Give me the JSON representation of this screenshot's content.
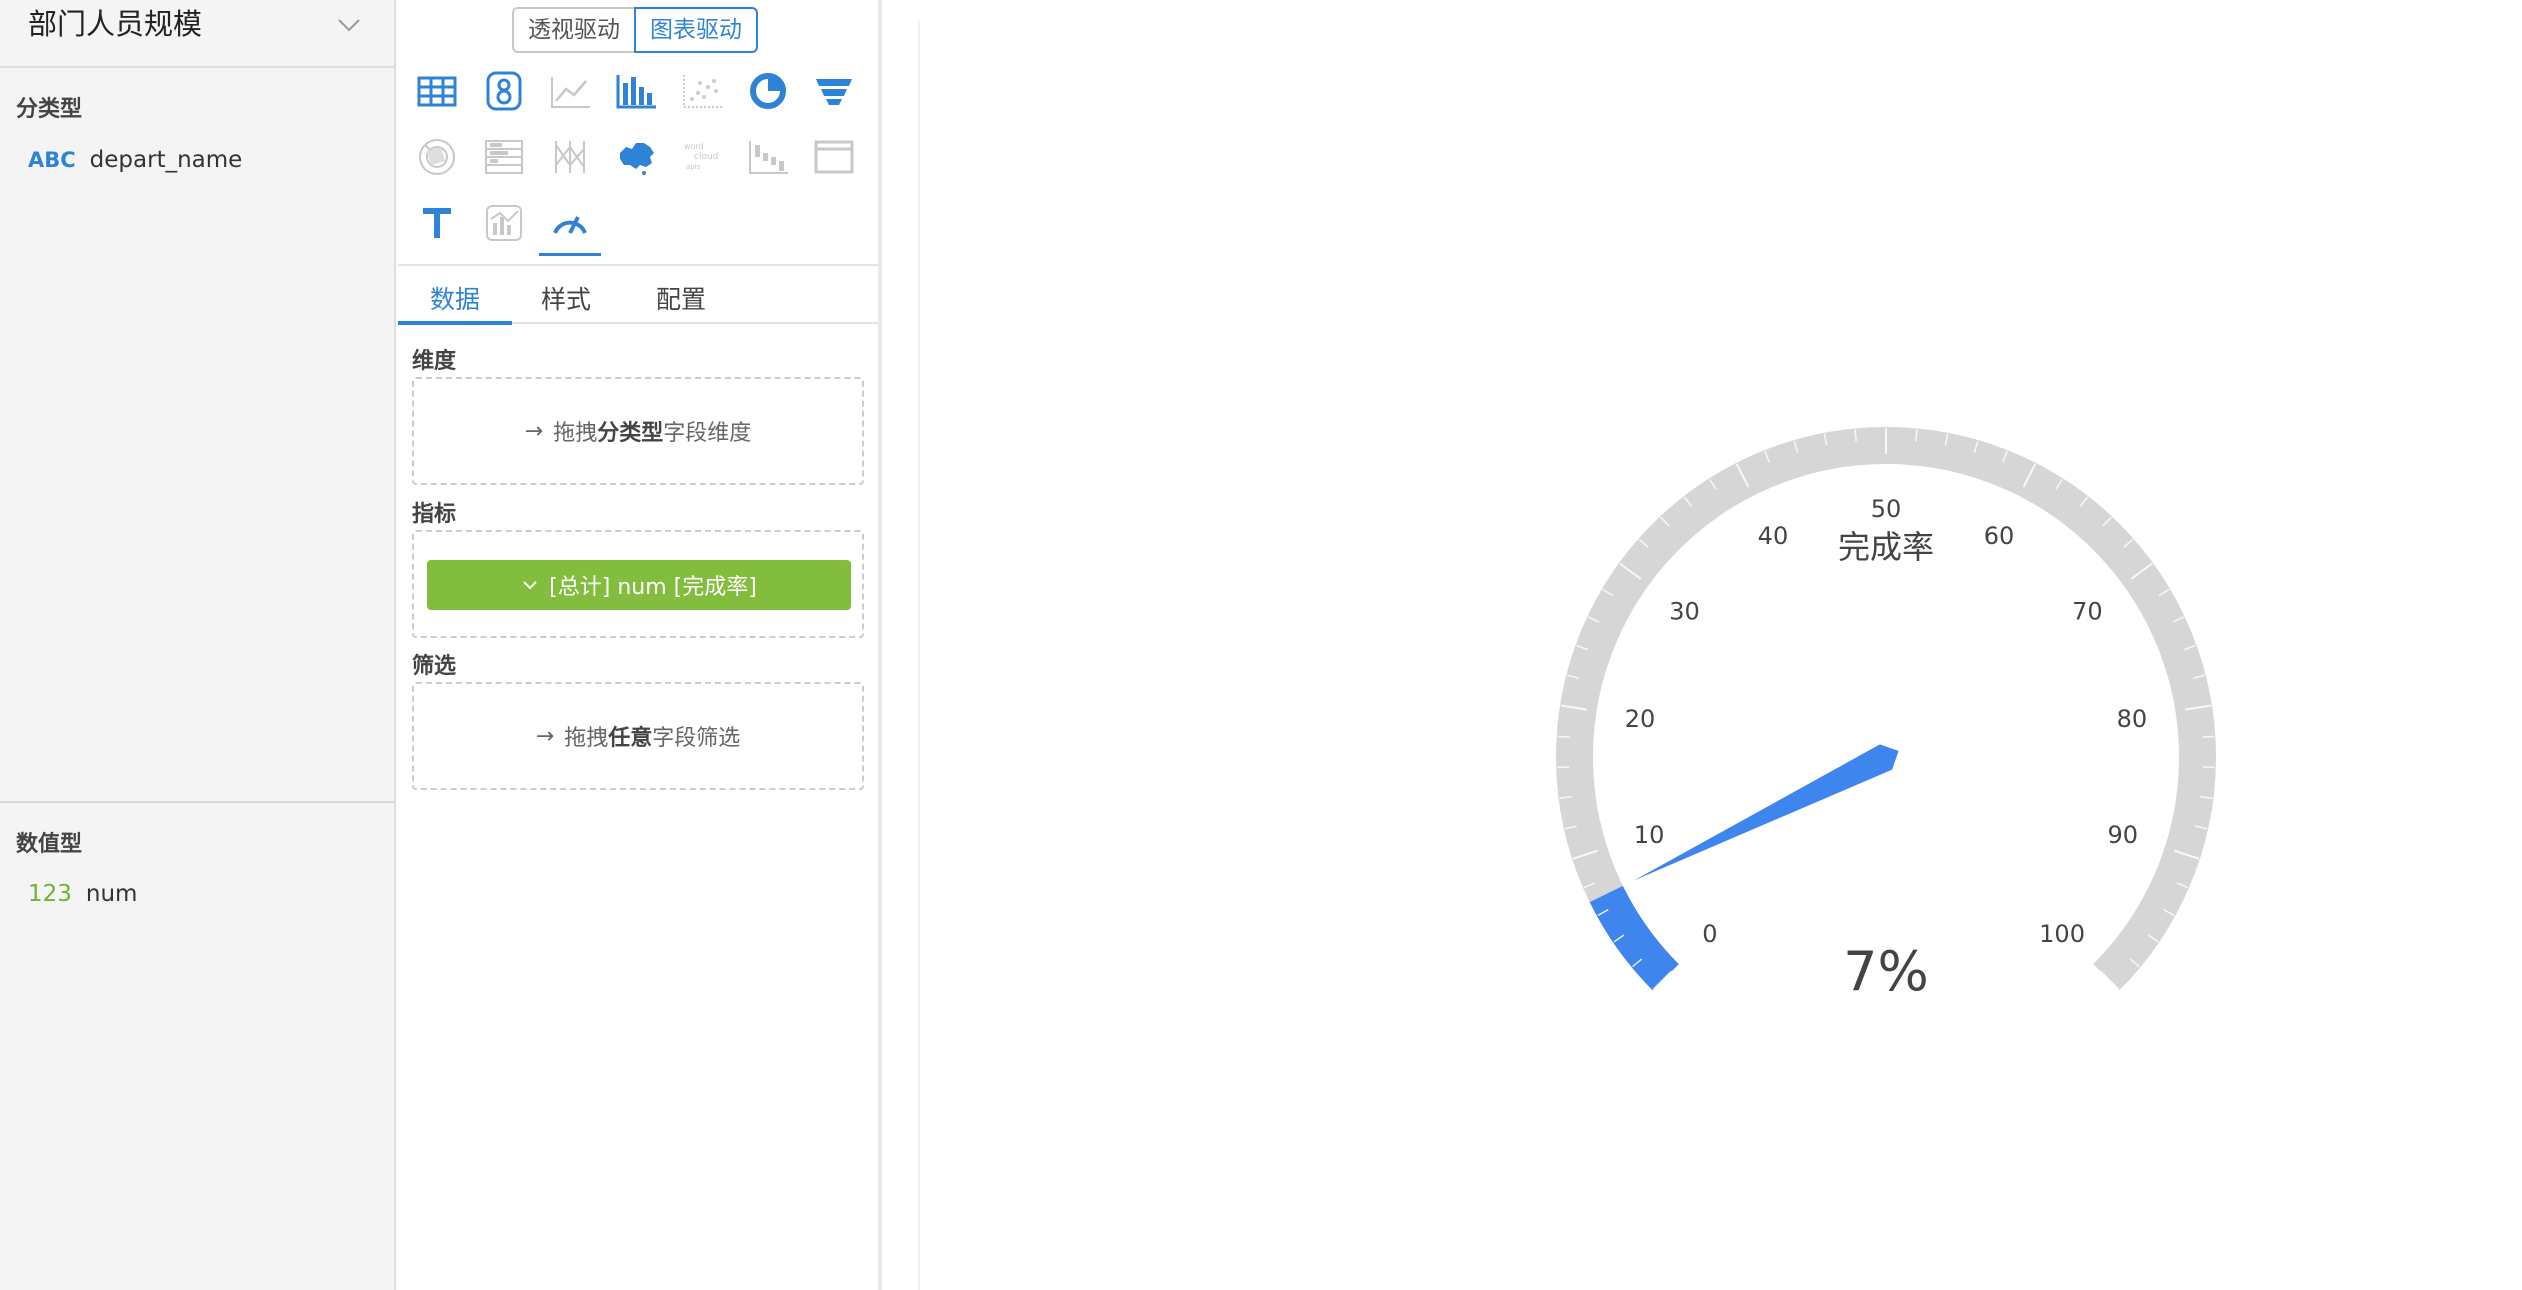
{
  "source": {
    "title": "部门人员规模"
  },
  "field_groups": [
    {
      "label": "分类型",
      "fields": [
        {
          "type_label": "ABC",
          "name": "depart_name",
          "type_color": "#2f83d6"
        }
      ]
    },
    {
      "label": "数值型",
      "fields": [
        {
          "type_label": "123",
          "name": "num",
          "type_color": "#6fb330"
        }
      ]
    }
  ],
  "mode_switch": {
    "options": [
      "透视驱动",
      "图表驱动"
    ],
    "active": "图表驱动"
  },
  "chart_types": [
    {
      "icon": "table-icon",
      "enabled": true
    },
    {
      "icon": "scorecard-icon",
      "enabled": true
    },
    {
      "icon": "line-chart-icon",
      "enabled": false
    },
    {
      "icon": "bar-chart-icon",
      "enabled": true
    },
    {
      "icon": "scatter-icon",
      "enabled": false
    },
    {
      "icon": "pie-chart-icon",
      "enabled": true
    },
    {
      "icon": "funnel-icon",
      "enabled": true
    },
    {
      "icon": "radar-icon",
      "enabled": false
    },
    {
      "icon": "parallel-bar-icon",
      "enabled": false
    },
    {
      "icon": "parallel-icon",
      "enabled": false
    },
    {
      "icon": "china-map-icon",
      "enabled": true
    },
    {
      "icon": "word-cloud-icon",
      "enabled": false
    },
    {
      "icon": "waterfall-icon",
      "enabled": false
    },
    {
      "icon": "web-widget-icon",
      "enabled": false
    },
    {
      "icon": "text-icon",
      "enabled": true
    },
    {
      "icon": "doubleaxis-icon",
      "enabled": false
    },
    {
      "icon": "gauge-icon",
      "enabled": true,
      "selected": true
    }
  ],
  "tabs": [
    "数据",
    "样式",
    "配置"
  ],
  "active_tab": "数据",
  "sections": {
    "dimension": {
      "label": "维度",
      "hint_prefix": "拖拽",
      "hint_bold": "分类型",
      "hint_suffix": "字段维度"
    },
    "metrics": {
      "label": "指标",
      "pill": "[总计] num [完成率]"
    },
    "filter": {
      "label": "筛选",
      "hint_prefix": "拖拽",
      "hint_bold": "任意",
      "hint_suffix": "字段筛选"
    }
  },
  "colors": {
    "accent": "#2f83d6",
    "gauge_fill": "#3e86ee",
    "gauge_track": "#d6d6d6",
    "metric_pill": "#82bd3e"
  },
  "chart_data": {
    "type": "gauge",
    "title": "完成率",
    "value": 7,
    "value_label": "7%",
    "min": 0,
    "max": 100,
    "tick_labels": [
      "0",
      "10",
      "20",
      "30",
      "40",
      "50",
      "60",
      "70",
      "80",
      "90",
      "100"
    ],
    "start_angle_deg": 225,
    "end_angle_deg": -45
  }
}
